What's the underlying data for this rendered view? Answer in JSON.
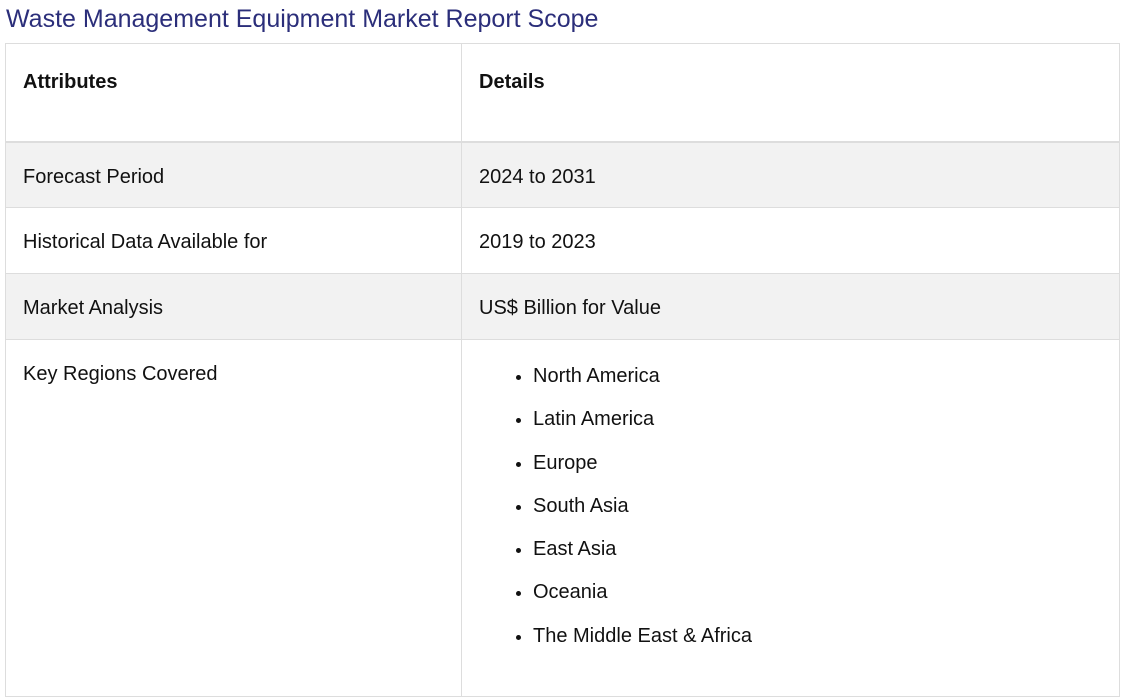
{
  "title": "Waste Management Equipment Market Report Scope",
  "table": {
    "headers": [
      "Attributes",
      "Details"
    ],
    "rows": [
      {
        "attribute": "Forecast Period",
        "detail": "2024 to 2031"
      },
      {
        "attribute": "Historical Data Available for",
        "detail": "2019 to 2023"
      },
      {
        "attribute": "Market Analysis",
        "detail": "US$ Billion for Value"
      },
      {
        "attribute": "Key Regions Covered",
        "detail_list": [
          "North America",
          "Latin America",
          "Europe",
          "South Asia",
          "East Asia",
          "Oceania",
          "The Middle East & Africa"
        ]
      }
    ]
  },
  "colors": {
    "title": "#2b2e7a",
    "shaded_row": "#f2f2f2",
    "border": "#dddddd"
  }
}
